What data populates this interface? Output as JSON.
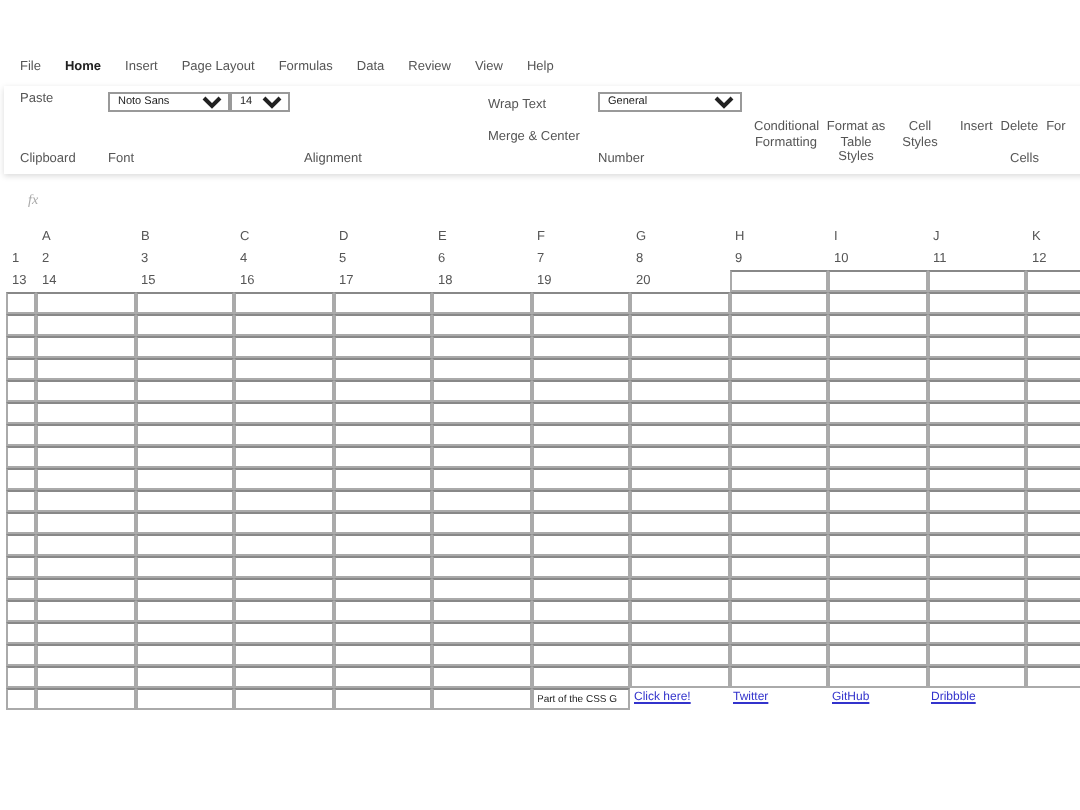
{
  "menu": [
    {
      "label": "File",
      "selected": false
    },
    {
      "label": "Home",
      "selected": true
    },
    {
      "label": "Insert",
      "selected": false
    },
    {
      "label": "Page Layout",
      "selected": false
    },
    {
      "label": "Formulas",
      "selected": false
    },
    {
      "label": "Data",
      "selected": false
    },
    {
      "label": "Review",
      "selected": false
    },
    {
      "label": "View",
      "selected": false
    },
    {
      "label": "Help",
      "selected": false
    }
  ],
  "ribbon": {
    "paste": "Paste",
    "font_family": "Noto Sans",
    "font_size": "14",
    "wrap_text": "Wrap Text",
    "merge_center": "Merge & Center",
    "number_format": "General",
    "conditional_formatting": "Conditional Formatting",
    "format_as_table": "Format as Table Styles",
    "cell_styles": "Cell Styles",
    "insert": "Insert",
    "delete": "Delete",
    "format": "For",
    "groups": [
      "Clipboard",
      "Font",
      "Alignment",
      "Number",
      "Cells"
    ]
  },
  "formula_bar": {
    "fx": "fx"
  },
  "sheet": {
    "columns": [
      "",
      "A",
      "B",
      "C",
      "D",
      "E",
      "F",
      "G",
      "H",
      "I",
      "J",
      "K"
    ],
    "rows": [
      {
        "cells": [
          {
            "kind": "text",
            "text": "1"
          },
          {
            "kind": "text",
            "text": "2"
          },
          {
            "kind": "text",
            "text": "3"
          },
          {
            "kind": "text",
            "text": "4"
          },
          {
            "kind": "text",
            "text": "5"
          },
          {
            "kind": "text",
            "text": "6"
          },
          {
            "kind": "text",
            "text": "7"
          },
          {
            "kind": "text",
            "text": "8"
          },
          {
            "kind": "text",
            "text": "9"
          },
          {
            "kind": "text",
            "text": "10"
          },
          {
            "kind": "text",
            "text": "11"
          },
          {
            "kind": "text",
            "text": "12"
          }
        ]
      },
      {
        "cells": [
          {
            "kind": "text",
            "text": "13"
          },
          {
            "kind": "text",
            "text": "14"
          },
          {
            "kind": "text",
            "text": "15"
          },
          {
            "kind": "text",
            "text": "16"
          },
          {
            "kind": "text",
            "text": "17"
          },
          {
            "kind": "text",
            "text": "18"
          },
          {
            "kind": "text",
            "text": "19"
          },
          {
            "kind": "text",
            "text": "20"
          },
          {
            "kind": "input"
          },
          {
            "kind": "input"
          },
          {
            "kind": "input"
          },
          {
            "kind": "input"
          }
        ]
      },
      {
        "cells": [
          {
            "kind": "input"
          },
          {
            "kind": "input"
          },
          {
            "kind": "input"
          },
          {
            "kind": "input"
          },
          {
            "kind": "input"
          },
          {
            "kind": "input"
          },
          {
            "kind": "input"
          },
          {
            "kind": "input"
          },
          {
            "kind": "input"
          },
          {
            "kind": "input"
          },
          {
            "kind": "input"
          },
          {
            "kind": "input"
          }
        ]
      },
      {
        "cells": [
          {
            "kind": "input"
          },
          {
            "kind": "input"
          },
          {
            "kind": "input"
          },
          {
            "kind": "input"
          },
          {
            "kind": "input"
          },
          {
            "kind": "input"
          },
          {
            "kind": "input"
          },
          {
            "kind": "input"
          },
          {
            "kind": "input"
          },
          {
            "kind": "input"
          },
          {
            "kind": "input"
          },
          {
            "kind": "input"
          }
        ]
      },
      {
        "cells": [
          {
            "kind": "input"
          },
          {
            "kind": "input"
          },
          {
            "kind": "input"
          },
          {
            "kind": "input"
          },
          {
            "kind": "input"
          },
          {
            "kind": "input"
          },
          {
            "kind": "input"
          },
          {
            "kind": "input"
          },
          {
            "kind": "input"
          },
          {
            "kind": "input"
          },
          {
            "kind": "input"
          },
          {
            "kind": "input"
          }
        ]
      },
      {
        "cells": [
          {
            "kind": "input"
          },
          {
            "kind": "input"
          },
          {
            "kind": "input"
          },
          {
            "kind": "input"
          },
          {
            "kind": "input"
          },
          {
            "kind": "input"
          },
          {
            "kind": "input"
          },
          {
            "kind": "input"
          },
          {
            "kind": "input"
          },
          {
            "kind": "input"
          },
          {
            "kind": "input"
          },
          {
            "kind": "input"
          }
        ]
      },
      {
        "cells": [
          {
            "kind": "input"
          },
          {
            "kind": "input"
          },
          {
            "kind": "input"
          },
          {
            "kind": "input"
          },
          {
            "kind": "input"
          },
          {
            "kind": "input"
          },
          {
            "kind": "input"
          },
          {
            "kind": "input"
          },
          {
            "kind": "input"
          },
          {
            "kind": "input"
          },
          {
            "kind": "input"
          },
          {
            "kind": "input"
          }
        ]
      },
      {
        "cells": [
          {
            "kind": "input"
          },
          {
            "kind": "input"
          },
          {
            "kind": "input"
          },
          {
            "kind": "input"
          },
          {
            "kind": "input"
          },
          {
            "kind": "input"
          },
          {
            "kind": "input"
          },
          {
            "kind": "input"
          },
          {
            "kind": "input"
          },
          {
            "kind": "input"
          },
          {
            "kind": "input"
          },
          {
            "kind": "input"
          }
        ]
      },
      {
        "cells": [
          {
            "kind": "input"
          },
          {
            "kind": "input"
          },
          {
            "kind": "input"
          },
          {
            "kind": "input"
          },
          {
            "kind": "input"
          },
          {
            "kind": "input"
          },
          {
            "kind": "input"
          },
          {
            "kind": "input"
          },
          {
            "kind": "input"
          },
          {
            "kind": "input"
          },
          {
            "kind": "input"
          },
          {
            "kind": "input"
          }
        ]
      },
      {
        "cells": [
          {
            "kind": "input"
          },
          {
            "kind": "input"
          },
          {
            "kind": "input"
          },
          {
            "kind": "input"
          },
          {
            "kind": "input"
          },
          {
            "kind": "input"
          },
          {
            "kind": "input"
          },
          {
            "kind": "input"
          },
          {
            "kind": "input"
          },
          {
            "kind": "input"
          },
          {
            "kind": "input"
          },
          {
            "kind": "input"
          }
        ]
      },
      {
        "cells": [
          {
            "kind": "input"
          },
          {
            "kind": "input"
          },
          {
            "kind": "input"
          },
          {
            "kind": "input"
          },
          {
            "kind": "input"
          },
          {
            "kind": "input"
          },
          {
            "kind": "input"
          },
          {
            "kind": "input"
          },
          {
            "kind": "input"
          },
          {
            "kind": "input"
          },
          {
            "kind": "input"
          },
          {
            "kind": "input"
          }
        ]
      },
      {
        "cells": [
          {
            "kind": "input"
          },
          {
            "kind": "input"
          },
          {
            "kind": "input"
          },
          {
            "kind": "input"
          },
          {
            "kind": "input"
          },
          {
            "kind": "input"
          },
          {
            "kind": "input"
          },
          {
            "kind": "input"
          },
          {
            "kind": "input"
          },
          {
            "kind": "input"
          },
          {
            "kind": "input"
          },
          {
            "kind": "input"
          }
        ]
      },
      {
        "cells": [
          {
            "kind": "input"
          },
          {
            "kind": "input"
          },
          {
            "kind": "input"
          },
          {
            "kind": "input"
          },
          {
            "kind": "input"
          },
          {
            "kind": "input"
          },
          {
            "kind": "input"
          },
          {
            "kind": "input"
          },
          {
            "kind": "input"
          },
          {
            "kind": "input"
          },
          {
            "kind": "input"
          },
          {
            "kind": "input"
          }
        ]
      },
      {
        "cells": [
          {
            "kind": "input"
          },
          {
            "kind": "input"
          },
          {
            "kind": "input"
          },
          {
            "kind": "input"
          },
          {
            "kind": "input"
          },
          {
            "kind": "input"
          },
          {
            "kind": "input"
          },
          {
            "kind": "input"
          },
          {
            "kind": "input"
          },
          {
            "kind": "input"
          },
          {
            "kind": "input"
          },
          {
            "kind": "input"
          }
        ]
      },
      {
        "cells": [
          {
            "kind": "input"
          },
          {
            "kind": "input"
          },
          {
            "kind": "input"
          },
          {
            "kind": "input"
          },
          {
            "kind": "input"
          },
          {
            "kind": "input"
          },
          {
            "kind": "input"
          },
          {
            "kind": "input"
          },
          {
            "kind": "input"
          },
          {
            "kind": "input"
          },
          {
            "kind": "input"
          },
          {
            "kind": "input"
          }
        ]
      },
      {
        "cells": [
          {
            "kind": "input"
          },
          {
            "kind": "input"
          },
          {
            "kind": "input"
          },
          {
            "kind": "input"
          },
          {
            "kind": "input"
          },
          {
            "kind": "input"
          },
          {
            "kind": "input"
          },
          {
            "kind": "input"
          },
          {
            "kind": "input"
          },
          {
            "kind": "input"
          },
          {
            "kind": "input"
          },
          {
            "kind": "input"
          }
        ]
      },
      {
        "cells": [
          {
            "kind": "input"
          },
          {
            "kind": "input"
          },
          {
            "kind": "input"
          },
          {
            "kind": "input"
          },
          {
            "kind": "input"
          },
          {
            "kind": "input"
          },
          {
            "kind": "input"
          },
          {
            "kind": "input"
          },
          {
            "kind": "input"
          },
          {
            "kind": "input"
          },
          {
            "kind": "input"
          },
          {
            "kind": "input"
          }
        ]
      },
      {
        "cells": [
          {
            "kind": "input"
          },
          {
            "kind": "input"
          },
          {
            "kind": "input"
          },
          {
            "kind": "input"
          },
          {
            "kind": "input"
          },
          {
            "kind": "input"
          },
          {
            "kind": "input"
          },
          {
            "kind": "input"
          },
          {
            "kind": "input"
          },
          {
            "kind": "input"
          },
          {
            "kind": "input"
          },
          {
            "kind": "input"
          }
        ]
      },
      {
        "cells": [
          {
            "kind": "input"
          },
          {
            "kind": "input"
          },
          {
            "kind": "input"
          },
          {
            "kind": "input"
          },
          {
            "kind": "input"
          },
          {
            "kind": "input"
          },
          {
            "kind": "input"
          },
          {
            "kind": "input"
          },
          {
            "kind": "input"
          },
          {
            "kind": "input"
          },
          {
            "kind": "input"
          },
          {
            "kind": "input"
          }
        ]
      },
      {
        "cells": [
          {
            "kind": "input"
          },
          {
            "kind": "input"
          },
          {
            "kind": "input"
          },
          {
            "kind": "input"
          },
          {
            "kind": "input"
          },
          {
            "kind": "input"
          },
          {
            "kind": "input"
          },
          {
            "kind": "input"
          },
          {
            "kind": "input"
          },
          {
            "kind": "input"
          },
          {
            "kind": "input"
          },
          {
            "kind": "input"
          }
        ]
      },
      {
        "cells": [
          {
            "kind": "input"
          },
          {
            "kind": "input"
          },
          {
            "kind": "input"
          },
          {
            "kind": "input"
          },
          {
            "kind": "input"
          },
          {
            "kind": "input"
          },
          {
            "kind": "input",
            "text": "Part of the CSS G"
          },
          {
            "kind": "link",
            "text": "Click here!"
          },
          {
            "kind": "link",
            "text": "Twitter"
          },
          {
            "kind": "link",
            "text": "GitHub"
          },
          {
            "kind": "link",
            "text": "Dribbble"
          },
          {
            "kind": "none"
          }
        ]
      }
    ]
  }
}
